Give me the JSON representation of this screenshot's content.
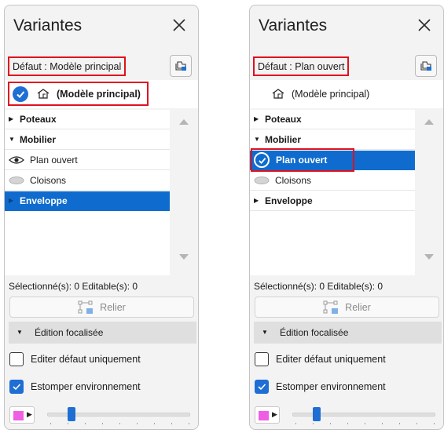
{
  "panels": [
    {
      "title": "Variantes",
      "default_label": "Défaut : Modèle principal",
      "model_label": "(Modèle principal)",
      "tree": {
        "poteaux": "Poteaux",
        "mobilier": "Mobilier",
        "plan_ouvert": "Plan ouvert",
        "cloisons": "Cloisons",
        "enveloppe": "Enveloppe"
      },
      "status": "Sélectionné(s): 0 Editable(s): 0",
      "relier": "Relier",
      "section": "Édition focalisée",
      "opt_editer": "Editer défaut uniquement",
      "opt_estomper": "Estomper environnement"
    },
    {
      "title": "Variantes",
      "default_label": "Défaut : Plan ouvert",
      "model_label": "(Modèle principal)",
      "tree": {
        "poteaux": "Poteaux",
        "mobilier": "Mobilier",
        "plan_ouvert": "Plan ouvert",
        "cloisons": "Cloisons",
        "enveloppe": "Enveloppe"
      },
      "status": "Sélectionné(s): 0 Editable(s): 0",
      "relier": "Relier",
      "section": "Édition focalisée",
      "opt_editer": "Editer défaut uniquement",
      "opt_estomper": "Estomper environnement"
    }
  ],
  "colors": {
    "selection": "#0f6cce",
    "check_blue": "#1f6ed4",
    "highlight_box": "#e0101e",
    "swatch": "#ef5fe6"
  },
  "icons": {
    "close": "close-icon",
    "folder": "folder-layers-icon",
    "model": "house-outline-icon",
    "visible": "eye-icon",
    "hidden": "hidden-oval-icon",
    "link": "link-nodes-icon"
  },
  "states": {
    "estomper_checked": true,
    "editer_checked": false
  }
}
